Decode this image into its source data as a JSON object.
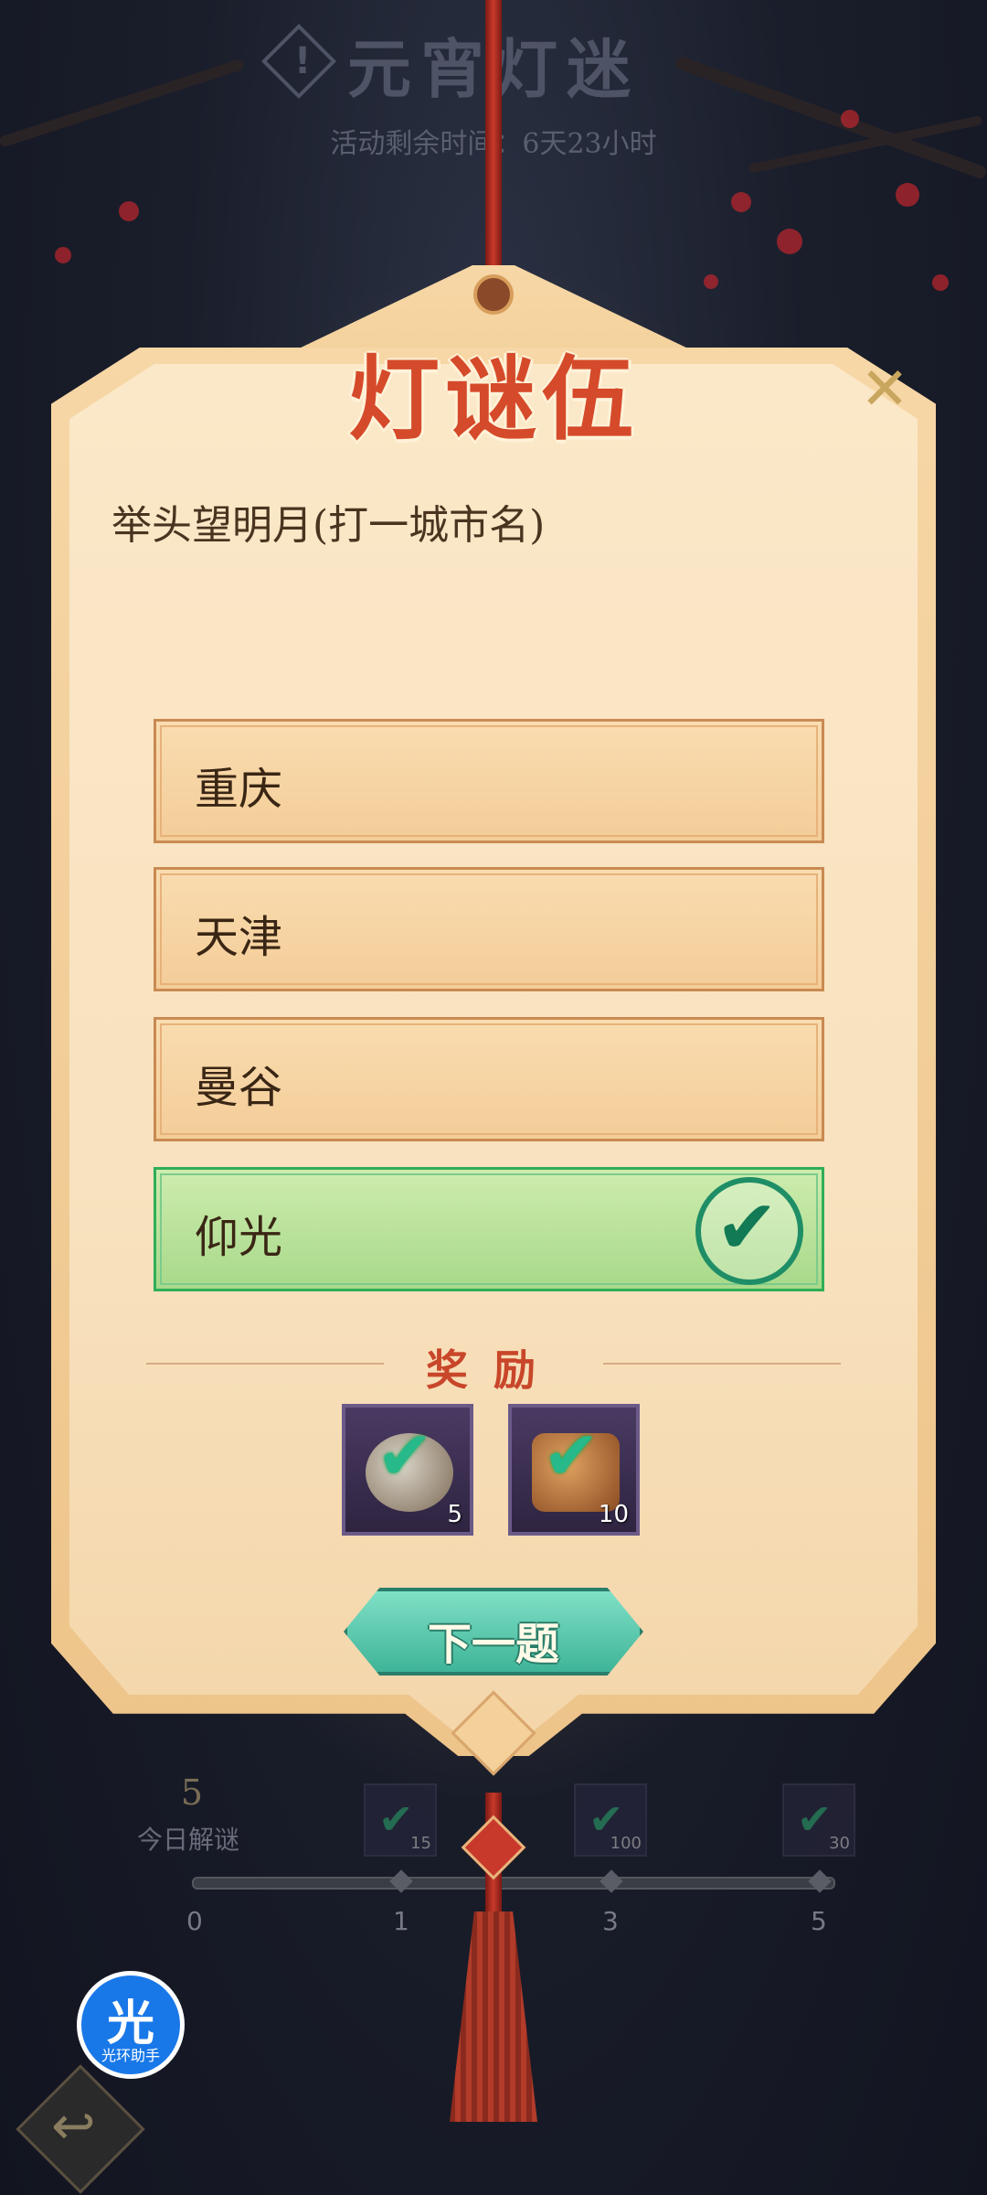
{
  "header": {
    "title": "元宵灯迷",
    "subtitle": "活动剩余时间：6天23小时"
  },
  "riddle": {
    "title": "灯谜伍",
    "question": "举头望明月(打一城市名)",
    "options": [
      {
        "label": "重庆",
        "selected": false
      },
      {
        "label": "天津",
        "selected": false
      },
      {
        "label": "曼谷",
        "selected": false
      },
      {
        "label": "仰光",
        "selected": true,
        "state": "correct"
      }
    ]
  },
  "reward": {
    "title": "奖励",
    "items": [
      {
        "name": "stone-item-icon",
        "quantity": "5"
      },
      {
        "name": "scroll-item-icon",
        "quantity": "10"
      }
    ]
  },
  "next_button": {
    "label": "下一题"
  },
  "progress": {
    "solved_count": "5",
    "label": "今日解谜",
    "milestones": [
      "0",
      "1",
      "3",
      "5"
    ],
    "rewards": [
      {
        "quantity": "15"
      },
      {
        "quantity": "100"
      },
      {
        "quantity": "30"
      }
    ]
  },
  "helper": {
    "glyph": "光",
    "label": "光环助手"
  },
  "colors": {
    "correct_green": "#2fae58",
    "title_red": "#d54a2a",
    "panel_bg": "#fbe8c8",
    "next_button": "#3fb497"
  }
}
